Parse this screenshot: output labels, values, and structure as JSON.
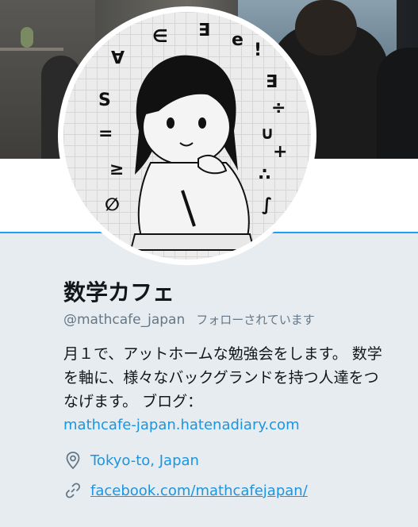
{
  "profile": {
    "name": "数学カフェ",
    "handle": "@mathcafe_japan",
    "follows_you": "フォローされています",
    "bio": "月１で、アットホームな勉強会をします。 数学を軸に、様々なバックグランドを持つ人達をつなげます。 ブログ：",
    "bio_link": "mathcafe-japan.hatenadiary.com",
    "location": "Tokyo-to, Japan",
    "website": "facebook.com/mathcafejapan/"
  },
  "avatar": {
    "symbols": [
      "∀",
      "∈",
      "∃",
      "e",
      "!",
      "∃",
      "÷",
      "∪",
      "+",
      "∴",
      "∫",
      "∅",
      "≥",
      "=",
      "S"
    ]
  },
  "icons": {
    "location": "map-pin-icon",
    "website": "link-icon"
  },
  "colors": {
    "accent": "#1da1f2",
    "link": "#1b95e0",
    "muted": "#657786",
    "page_bg": "#e6ecf0"
  }
}
